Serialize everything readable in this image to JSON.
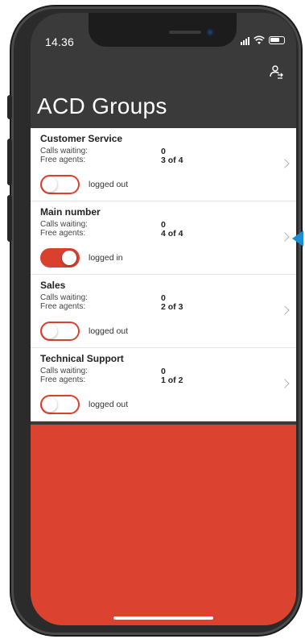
{
  "status_bar": {
    "time": "14.36"
  },
  "header": {
    "title": "ACD Groups",
    "agent_icon": "agent-status-icon"
  },
  "groups": [
    {
      "name": "Customer Service",
      "calls_label": "Calls waiting:",
      "calls_value": "0",
      "agents_label": "Free agents:",
      "agents_value": "3 of 4",
      "status": "logged out",
      "logged_in": false
    },
    {
      "name": "Main number",
      "calls_label": "Calls waiting:",
      "calls_value": "0",
      "agents_label": "Free agents:",
      "agents_value": "4 of 4",
      "status": "logged in",
      "logged_in": true
    },
    {
      "name": "Sales",
      "calls_label": "Calls waiting:",
      "calls_value": "0",
      "agents_label": "Free agents:",
      "agents_value": "2 of 3",
      "status": "logged out",
      "logged_in": false
    },
    {
      "name": "Technical Support",
      "calls_label": "Calls waiting:",
      "calls_value": "0",
      "agents_label": "Free agents:",
      "agents_value": "1 of 2",
      "status": "logged out",
      "logged_in": false
    }
  ],
  "colors": {
    "accent": "#db4230",
    "header_bg": "#3a3a3a",
    "pointer": "#1a8fd6"
  }
}
